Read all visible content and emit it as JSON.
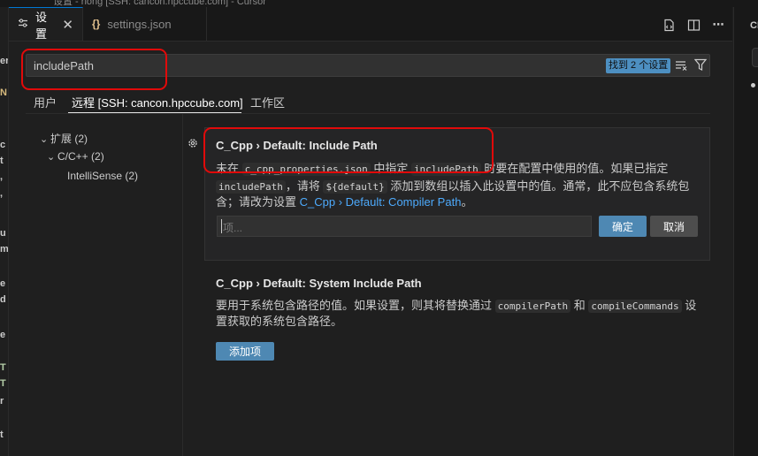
{
  "window_title": "设置 - rlong [SSH: cancon.hpccube.com] - Cursor",
  "tabs": [
    {
      "label": "设置",
      "icon": "settings-sliders-icon",
      "active": true
    },
    {
      "label": "settings.json",
      "icon": "json-braces-icon",
      "active": false
    }
  ],
  "toolbar_icons": [
    "open-json-icon",
    "split-editor-icon",
    "more-actions-icon"
  ],
  "search": {
    "value": "includePath",
    "count": "找到 2 个设置"
  },
  "scopes": [
    {
      "label": "用户"
    },
    {
      "label": "远程 [SSH: cancon.hpccube.com]",
      "active": true
    },
    {
      "label": "工作区"
    }
  ],
  "toc": [
    {
      "label": "扩展",
      "count": "(2)"
    },
    {
      "label": "C/C++",
      "count": "(2)"
    },
    {
      "label": "IntelliSense",
      "count": "(2)"
    }
  ],
  "setting1": {
    "category": "C_Cpp › Default: ",
    "name": "Include Path",
    "desc": {
      "p1": "未在 ",
      "c1": "c_cpp_properties.json",
      "p2": " 中指定 ",
      "c2": "includePath",
      "p3": " 时要在配置中使用的值。如果已指定",
      "c3": "includePath",
      "p4": "，请将 ",
      "c4": "${default}",
      "p5": " 添加到数组以插入此设置中的值。通常，此不应包含系统包",
      "p6": "含；请改为设置 ",
      "link": "C_Cpp › Default: Compiler Path",
      "p7": "。"
    },
    "input_placeholder": "项...",
    "ok_label": "确定",
    "cancel_label": "取消"
  },
  "setting2": {
    "category": "C_Cpp › Default: ",
    "name": "System Include Path",
    "desc": {
      "p1": "要用于系统包含路径的值。如果设置，则其将替换通过 ",
      "c1": "compilerPath",
      "p2": " 和 ",
      "c2": "compileCommands",
      "p3": " 设",
      "p4": "置获取的系统包含路径。"
    },
    "add_label": "添加项"
  },
  "right_panel": {
    "title": "CH"
  },
  "left_peek": [
    "er",
    "N",
    "c",
    "t",
    ",",
    ",",
    "u",
    "m",
    "e",
    "d",
    "e",
    "T",
    "T",
    "r",
    "t"
  ],
  "colors": {
    "accent": "#0078d4",
    "button": "#4e88b3",
    "link": "#4daafc",
    "annotation": "#e10a0a",
    "background": "#1f1f1f"
  }
}
